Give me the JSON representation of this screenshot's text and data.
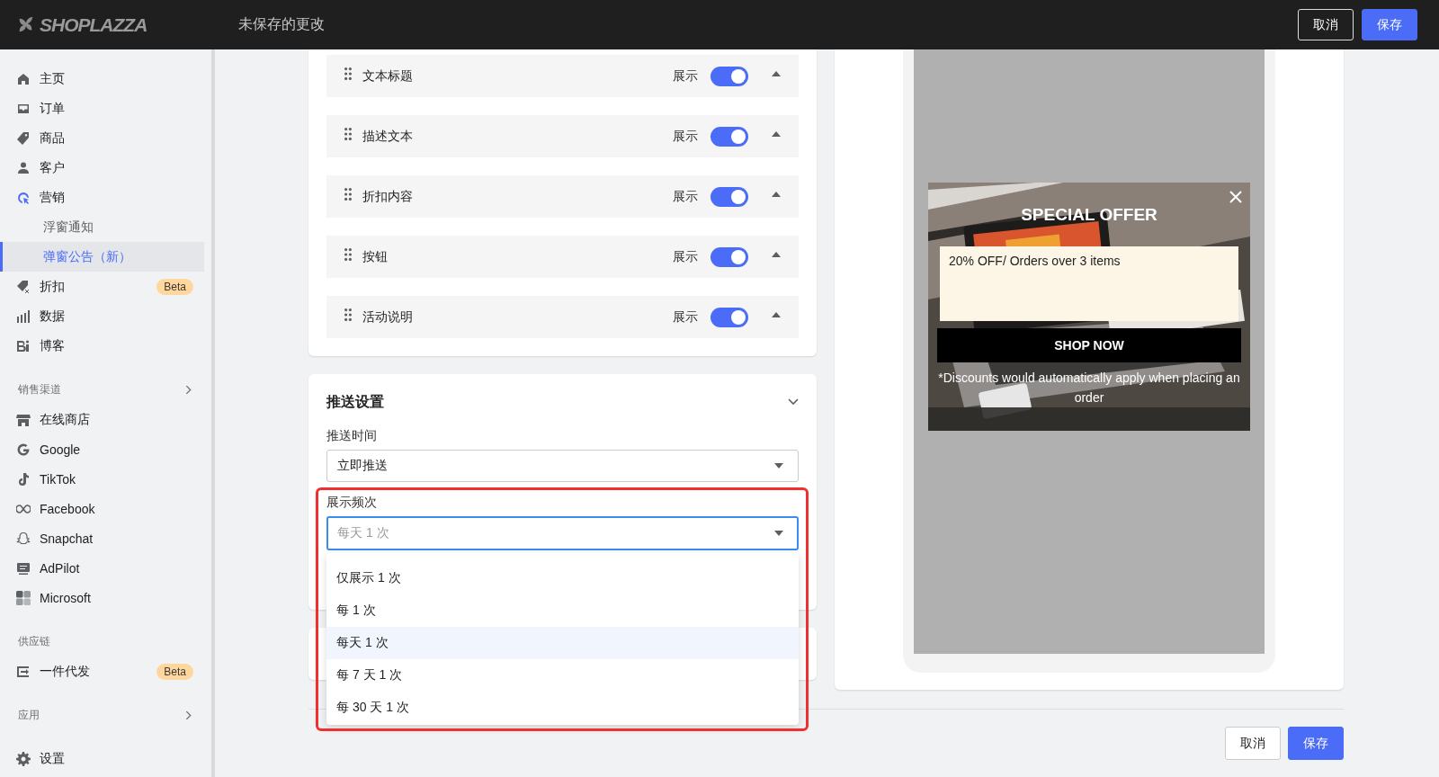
{
  "header": {
    "logo_text": "SHOPLAZZA",
    "title": "未保存的更改",
    "buttons": [
      {
        "label": "取消",
        "kind": "secondary"
      },
      {
        "label": "保存",
        "kind": "primary"
      }
    ]
  },
  "sidebar": {
    "sections": [
      {
        "items": [
          {
            "label": "主页"
          },
          {
            "label": "订单"
          },
          {
            "label": "商品"
          },
          {
            "label": "客户"
          },
          {
            "label": "营销",
            "expanded": true,
            "children": [
              {
                "label": "浮窗通知",
                "selected": false
              },
              {
                "label": "弹窗公告（新）",
                "selected": true
              }
            ]
          },
          {
            "label": "折扣",
            "badge": "Beta"
          },
          {
            "label": "数据"
          },
          {
            "label": "博客"
          }
        ]
      },
      {
        "title": "销售渠道",
        "collapsible": true,
        "items": [
          {
            "label": "在线商店"
          },
          {
            "label": "Google"
          },
          {
            "label": "TikTok"
          },
          {
            "label": "Facebook"
          },
          {
            "label": "Snapchat"
          },
          {
            "label": "AdPilot"
          },
          {
            "label": "Microsoft"
          }
        ]
      },
      {
        "title": "供应链",
        "items": [
          {
            "label": "一件代发",
            "badge": "Beta"
          }
        ]
      },
      {
        "title": "应用",
        "collapsible": true
      },
      {
        "items": [
          {
            "label": "设置"
          }
        ]
      }
    ]
  },
  "content_rows": [
    {
      "label": "文本标题",
      "toggle_label": "展示",
      "on": true
    },
    {
      "label": "描述文本",
      "toggle_label": "展示",
      "on": true
    },
    {
      "label": "折扣内容",
      "toggle_label": "展示",
      "on": true
    },
    {
      "label": "按钮",
      "toggle_label": "展示",
      "on": true
    },
    {
      "label": "活动说明",
      "toggle_label": "展示",
      "on": true
    }
  ],
  "push_settings": {
    "title": "推送设置",
    "fields": [
      {
        "label": "推送时间",
        "value": "立即推送",
        "focused": false
      },
      {
        "label": "展示频次",
        "placeholder": "每天 1 次",
        "focused": true,
        "highlighted": true,
        "options": [
          {
            "label": "仅展示 1 次",
            "selected": false
          },
          {
            "label": "每 1 次",
            "selected": false
          },
          {
            "label": "每天 1 次",
            "selected": true
          },
          {
            "label": "每 7 天 1 次",
            "selected": false
          },
          {
            "label": "每 30 天 1 次",
            "selected": false
          }
        ]
      }
    ]
  },
  "preview": {
    "title": "SPECIAL OFFER",
    "offer": "20% OFF/ Orders over 3 items",
    "button": "SHOP NOW",
    "note": "*Discounts would automatically apply when placing an order"
  },
  "footer_buttons": [
    {
      "label": "取消",
      "kind": "secondary"
    },
    {
      "label": "保存",
      "kind": "primary"
    }
  ]
}
